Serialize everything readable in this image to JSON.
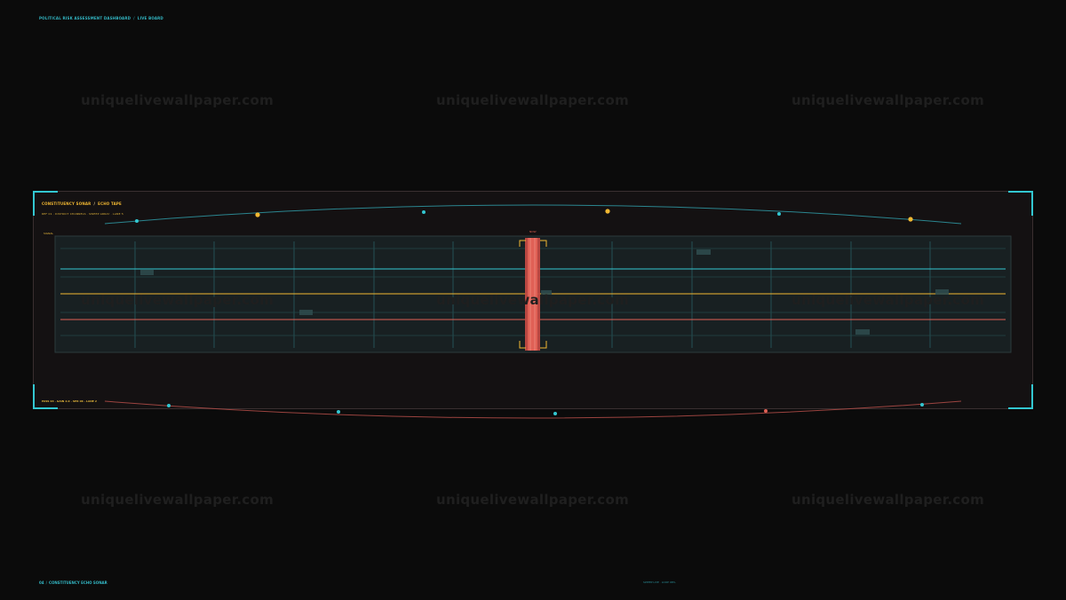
{
  "header": {
    "breadcrumb_root": "POLITICAL RISK ASSESSMENT DASHBOARD",
    "breadcrumb_separator": "/",
    "breadcrumb_current": "LIVE BOARD"
  },
  "watermark": {
    "text": "uniquelivewallpaper.com"
  },
  "panel": {
    "title": "CONSTITUENCY SONAR",
    "title_separator": "/",
    "title_current": "ECHO TAPE",
    "subtitle": "REF 01  ·  DISTRICT CHANNELS  ·  SWEEP ARRAY  ·  LANE 5",
    "track_tag": "SIGNAL",
    "cursor_label": "NOW",
    "footer": "PASS 04  ·  GAIN 2.0  ·  SPR 06  ·  LANE 2"
  },
  "footer": {
    "left_code": "04",
    "left_separator": "/",
    "left_title": "CONSTITUENCY ECHO SONAR",
    "right_text": "SWEEP LIVE  ·  LOOP 98%"
  },
  "timeline": {
    "ticks": [
      "",
      "",
      "",
      "",
      "",
      "",
      "",
      "",
      "",
      "",
      "",
      "",
      "",
      ""
    ]
  },
  "colors": {
    "teal": "#33c7d1",
    "gold": "#f2b832",
    "red": "#e06055",
    "panel_bg": "#141112",
    "tape_bg": "#182022"
  }
}
